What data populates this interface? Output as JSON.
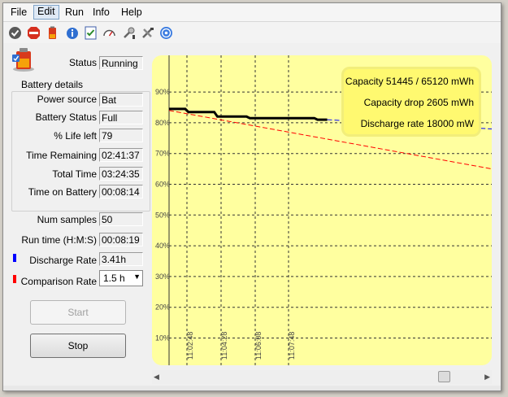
{
  "menu": [
    "File",
    "Edit",
    "Run",
    "Info",
    "Help"
  ],
  "status": {
    "label": "Status",
    "value": "Running"
  },
  "battery_details": {
    "title": "Battery details",
    "rows": [
      {
        "label": "Power source",
        "value": "Bat"
      },
      {
        "label": "Battery Status",
        "value": "Full"
      },
      {
        "label": "% Life left",
        "value": "79"
      },
      {
        "label": "Time Remaining",
        "value": "02:41:37"
      },
      {
        "label": "Total Time",
        "value": "03:24:35"
      },
      {
        "label": "Time on Battery",
        "value": "00:08:14"
      }
    ]
  },
  "stats": {
    "num_samples": {
      "label": "Num samples",
      "value": "50"
    },
    "run_time": {
      "label": "Run time (H:M:S)",
      "value": "00:08:19"
    },
    "discharge_rate": {
      "label": "Discharge Rate",
      "value": "3.41h",
      "color": "#0000ff"
    },
    "comparison_rate": {
      "label": "Comparison Rate",
      "value": "1.5 h",
      "color": "#ff0000"
    }
  },
  "buttons": {
    "start": "Start",
    "stop": "Stop"
  },
  "chart_info": {
    "capacity": "Capacity 51445 / 65120 mWh",
    "capacity_drop": "Capacity drop 2605 mWh",
    "discharge_rate": "Discharge rate 18000 mW"
  },
  "chart_data": {
    "type": "line",
    "y_ticks": [
      "90%",
      "80%",
      "70%",
      "60%",
      "50%",
      "40%",
      "30%",
      "20%",
      "10%"
    ],
    "x_ticks": [
      "11:02:48",
      "11:04:28",
      "11:06:08",
      "11:07:48"
    ],
    "ylim": [
      0,
      100
    ],
    "grid": true,
    "series": [
      {
        "color": "#000000",
        "style": "solid",
        "points": [
          [
            0,
            84.5
          ],
          [
            5,
            84.5
          ],
          [
            6,
            83.5
          ],
          [
            14,
            83.5
          ],
          [
            15,
            82
          ],
          [
            24,
            82
          ],
          [
            25,
            81.5
          ],
          [
            45,
            81.5
          ],
          [
            46,
            81
          ],
          [
            49,
            81
          ]
        ]
      },
      {
        "color": "#0000ff",
        "style": "dashed",
        "points": [
          [
            49,
            81
          ],
          [
            100,
            78
          ]
        ]
      },
      {
        "color": "#ff0000",
        "style": "dashed",
        "points": [
          [
            0,
            84
          ],
          [
            100,
            65
          ]
        ]
      }
    ]
  }
}
